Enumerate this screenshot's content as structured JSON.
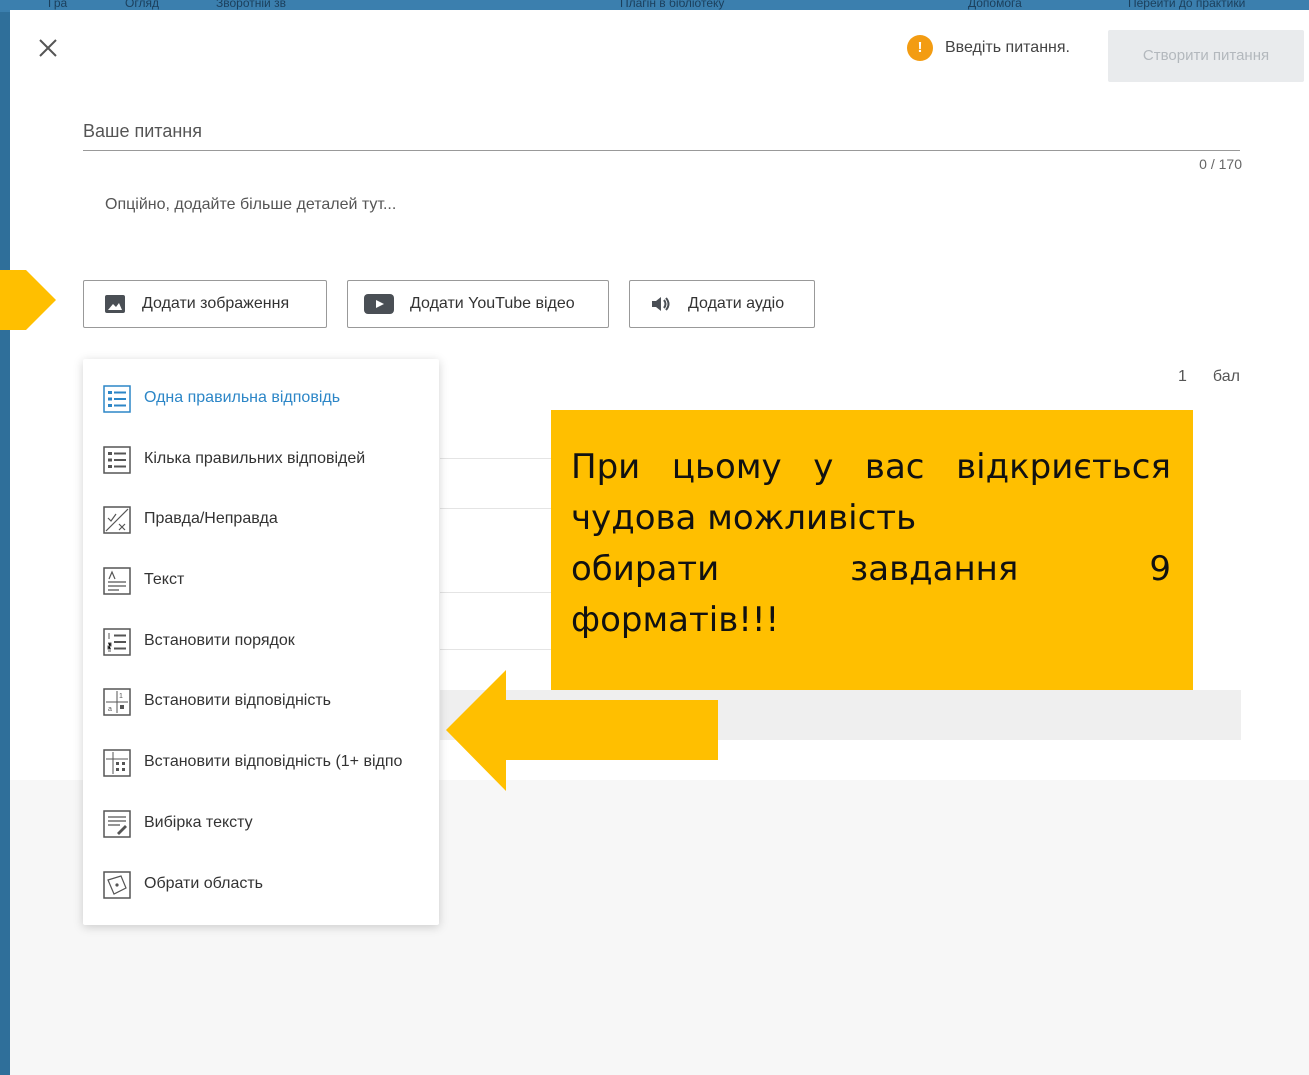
{
  "topbar": {
    "items": [
      "Гра",
      "Огляд",
      "Зворотній зв",
      "Плагін в бібліотеку",
      "Допомога",
      "Перейти до практики"
    ]
  },
  "header": {
    "warning_text": "Введіть питання.",
    "create_button": "Створити питання"
  },
  "question": {
    "placeholder": "Ваше питання",
    "counter": "0 / 170",
    "details_placeholder": "Опційно, додайте більше деталей тут..."
  },
  "media_buttons": {
    "image": "Додати зображення",
    "youtube": "Додати YouTube відео",
    "audio": "Додати аудіо"
  },
  "points": {
    "value": "1",
    "unit": "бал"
  },
  "type_menu": {
    "items": [
      {
        "label": "Одна правильна відповідь",
        "icon": "single-choice-icon"
      },
      {
        "label": "Кілька правильних відповідей",
        "icon": "multiple-choice-icon"
      },
      {
        "label": "Правда/Неправда",
        "icon": "true-false-icon"
      },
      {
        "label": "Текст",
        "icon": "text-icon"
      },
      {
        "label": "Встановити порядок",
        "icon": "order-icon"
      },
      {
        "label": "Встановити відповідність",
        "icon": "match-icon"
      },
      {
        "label": "Встановити відповідність (1+ відпо",
        "icon": "match-multi-icon"
      },
      {
        "label": "Вибірка тексту",
        "icon": "text-select-icon"
      },
      {
        "label": "Обрати область",
        "icon": "area-select-icon"
      }
    ]
  },
  "callout": {
    "line1": [
      "При",
      "цьому",
      "у",
      "вас",
      "відкриється"
    ],
    "line2": "чудова можливість",
    "line3": [
      "обирати",
      "завдання",
      "9"
    ],
    "line4": "форматів!!!"
  },
  "colors": {
    "accent_yellow": "#ffbf00",
    "active_blue": "#2c86c7",
    "warning_orange": "#f39c12"
  }
}
